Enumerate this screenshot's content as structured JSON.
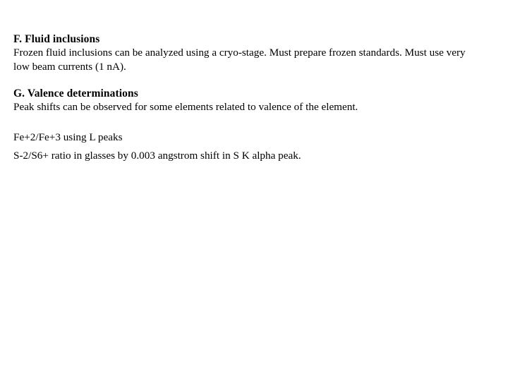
{
  "slide": {
    "background_color": "#ffffff",
    "text_color": "#000000",
    "sections": [
      {
        "heading": "F.  Fluid inclusions",
        "body": "Frozen fluid inclusions can be analyzed using a cryo-stage.  Must prepare frozen standards.  Must use very low beam currents (1 nA)."
      },
      {
        "heading": "G.  Valence determinations",
        "body": "Peak shifts can be observed for some elements related to valence of the element."
      }
    ],
    "notes": [
      "Fe+2/Fe+3 using L peaks",
      "S-2/S6+ ratio in glasses by 0.003 angstrom shift in S K alpha peak."
    ]
  }
}
